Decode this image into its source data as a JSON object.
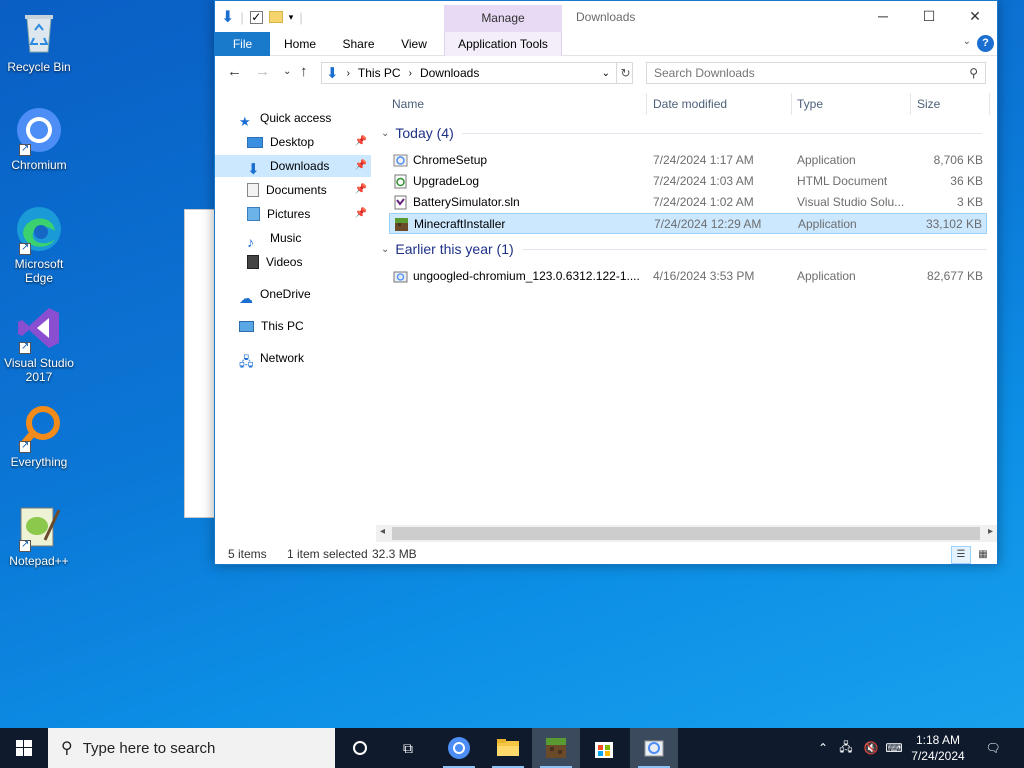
{
  "desktop": {
    "icons": [
      {
        "label": "Recycle Bin"
      },
      {
        "label": "Chromium"
      },
      {
        "label": "Microsoft Edge"
      },
      {
        "label": "Visual Studio 2017"
      },
      {
        "label": "Everything"
      },
      {
        "label": "Notepad++"
      }
    ]
  },
  "window": {
    "title": "Downloads",
    "manage_tab": "Manage",
    "ribbon_tabs": [
      "File",
      "Home",
      "Share",
      "View",
      "Application Tools"
    ],
    "address": {
      "segments": [
        "This PC",
        "Downloads"
      ]
    },
    "search": {
      "placeholder": "Search Downloads"
    }
  },
  "nav": {
    "items": [
      {
        "label": "Quick access"
      },
      {
        "label": "Desktop"
      },
      {
        "label": "Downloads"
      },
      {
        "label": "Documents"
      },
      {
        "label": "Pictures"
      },
      {
        "label": "Music"
      },
      {
        "label": "Videos"
      },
      {
        "label": "OneDrive"
      },
      {
        "label": "This PC"
      },
      {
        "label": "Network"
      }
    ]
  },
  "columns": {
    "name": "Name",
    "date": "Date modified",
    "type": "Type",
    "size": "Size"
  },
  "groups": [
    {
      "label": "Today (4)",
      "files": [
        {
          "name": "ChromeSetup",
          "date": "7/24/2024 1:17 AM",
          "type": "Application",
          "size": "8,706 KB",
          "icon": "chrome-setup-icon"
        },
        {
          "name": "UpgradeLog",
          "date": "7/24/2024 1:03 AM",
          "type": "HTML Document",
          "size": "36 KB",
          "icon": "html-file-icon"
        },
        {
          "name": "BatterySimulator.sln",
          "date": "7/24/2024 1:02 AM",
          "type": "Visual Studio Solu...",
          "size": "3 KB",
          "icon": "vs-solution-icon"
        },
        {
          "name": "MinecraftInstaller",
          "date": "7/24/2024 12:29 AM",
          "type": "Application",
          "size": "33,102 KB",
          "icon": "minecraft-icon"
        }
      ]
    },
    {
      "label": "Earlier this year (1)",
      "files": [
        {
          "name": "ungoogled-chromium_123.0.6312.122-1....",
          "date": "4/16/2024 3:53 PM",
          "type": "Application",
          "size": "82,677 KB",
          "icon": "installer-icon"
        }
      ]
    }
  ],
  "status": {
    "count": "5 items",
    "selected": "1 item selected",
    "size": "32.3 MB"
  },
  "taskbar": {
    "search_placeholder": "Type here to search",
    "time": "1:18 AM",
    "date": "7/24/2024"
  },
  "colors": {
    "accent": "#1979ca",
    "selection": "#cce8ff",
    "manage": "#e8d9f5",
    "taskbar": "#0f1b2d"
  }
}
